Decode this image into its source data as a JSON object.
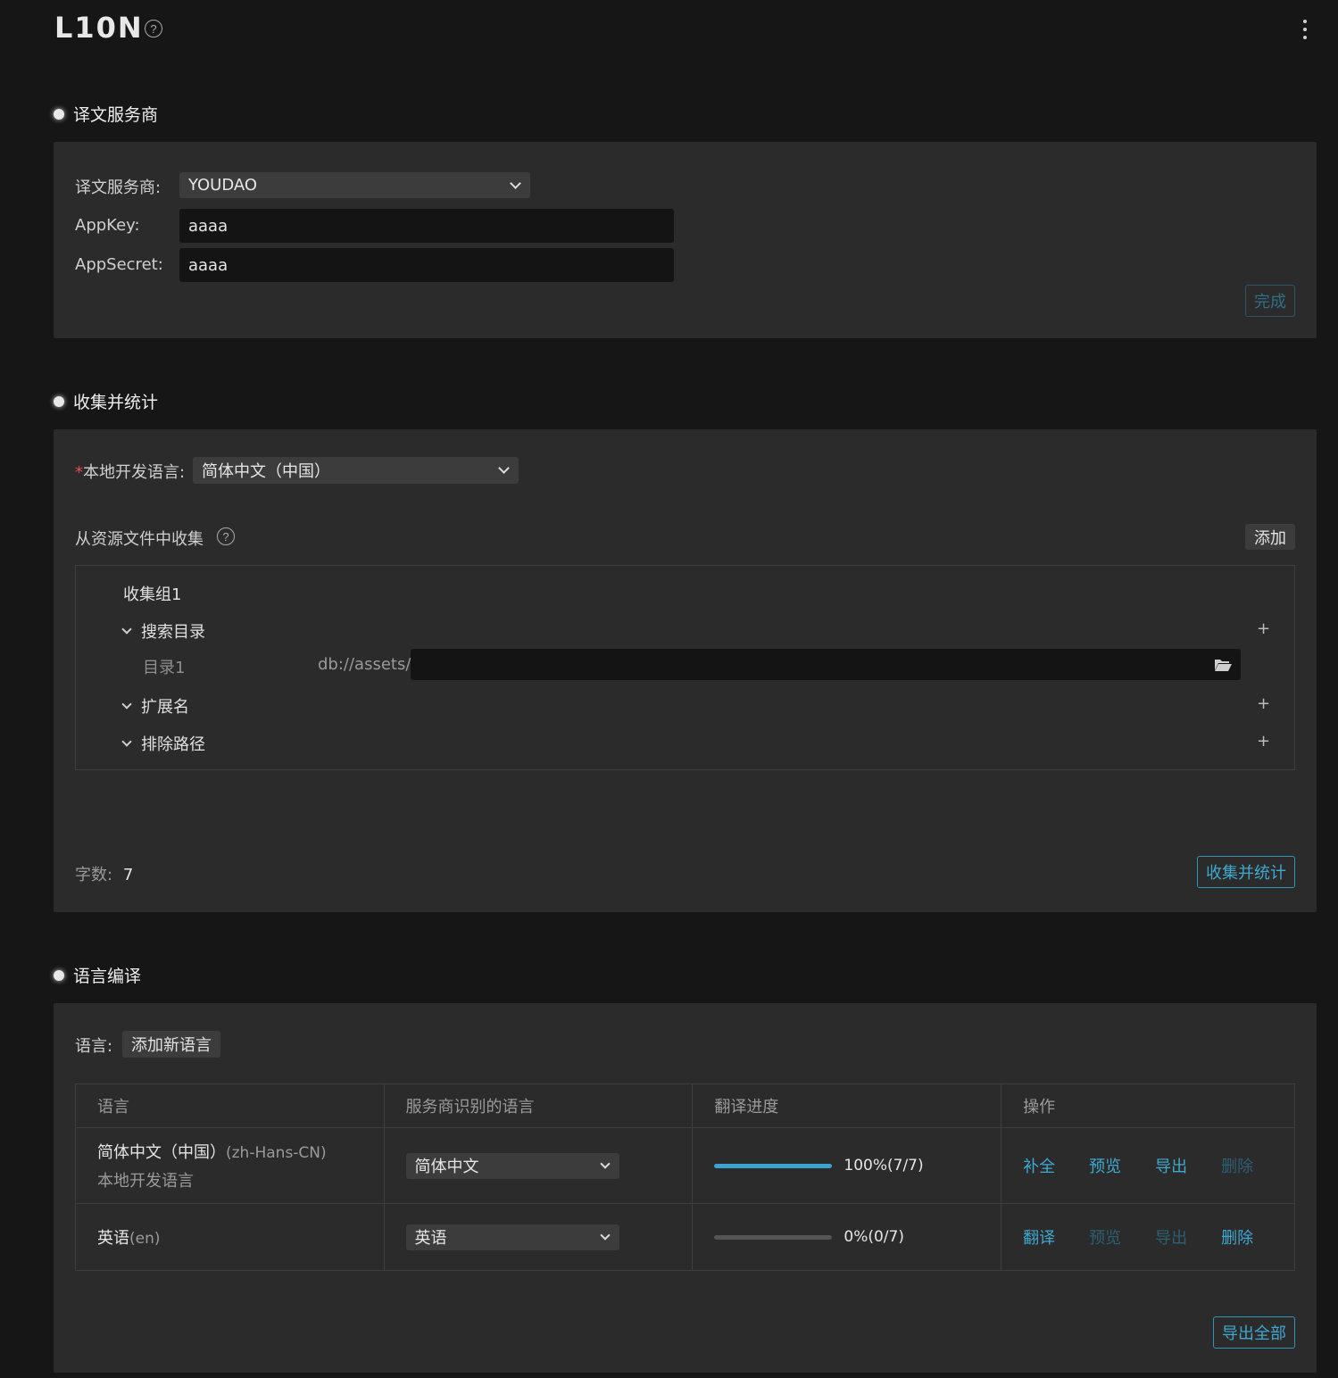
{
  "app": {
    "title": "L10N",
    "help_glyph": "?"
  },
  "sections": {
    "provider": {
      "heading": "译文服务商",
      "provider_label": "译文服务商:",
      "provider_value": "YOUDAO",
      "appkey_label": "AppKey:",
      "appkey_value": "aaaa",
      "appsecret_label": "AppSecret:",
      "appsecret_value": "aaaa",
      "done_button": "完成"
    },
    "collect": {
      "heading": "收集并统计",
      "required_mark": "*",
      "dev_lang_label": "本地开发语言:",
      "dev_lang_value": "简体中文（中国）",
      "from_resources_label": "从资源文件中收集",
      "add_button": "添加",
      "group": {
        "title": "收集组1",
        "search_dirs_label": "搜索目录",
        "dir_item_label": "目录1",
        "dir_prefix": "db://assets/",
        "dir_value": "",
        "extensions_label": "扩展名",
        "exclude_label": "排除路径",
        "plus_glyph": "+"
      },
      "word_count_label": "字数:",
      "word_count_value": "7",
      "collect_button": "收集并统计"
    },
    "compile": {
      "heading": "语言编译",
      "language_label": "语言:",
      "add_language_button": "添加新语言",
      "table": {
        "headers": [
          "语言",
          "服务商识别的语言",
          "翻译进度",
          "操作"
        ],
        "rows": [
          {
            "lang_name": "简体中文（中国）",
            "lang_code": "(zh-Hans-CN)",
            "lang_note": "本地开发语言",
            "provider_lang": "简体中文",
            "progress": 1.0,
            "progress_text": "100%(7/7)",
            "actions": [
              {
                "label": "补全",
                "enabled": true
              },
              {
                "label": "预览",
                "enabled": true
              },
              {
                "label": "导出",
                "enabled": true
              },
              {
                "label": "删除",
                "enabled": false
              }
            ]
          },
          {
            "lang_name": "英语",
            "lang_code": "(en)",
            "lang_note": "",
            "provider_lang": "英语",
            "progress": 0.0,
            "progress_text": "0%(0/7)",
            "actions": [
              {
                "label": "翻译",
                "enabled": true
              },
              {
                "label": "预览",
                "enabled": false
              },
              {
                "label": "导出",
                "enabled": false
              },
              {
                "label": "删除",
                "enabled": true
              }
            ]
          }
        ]
      },
      "export_all_button": "导出全部"
    }
  },
  "icons": {
    "help": "help-circle-icon",
    "menu": "kebab-menu-icon",
    "folder": "folder-open-icon",
    "chevron": "chevron-down-icon"
  },
  "colors": {
    "background": "#161616",
    "panel": "#2b2b2b",
    "accent": "#3fa8cf",
    "accent_disabled": "#2c5f72",
    "input_bg": "#141414",
    "select_bg": "#3c3c3c"
  }
}
